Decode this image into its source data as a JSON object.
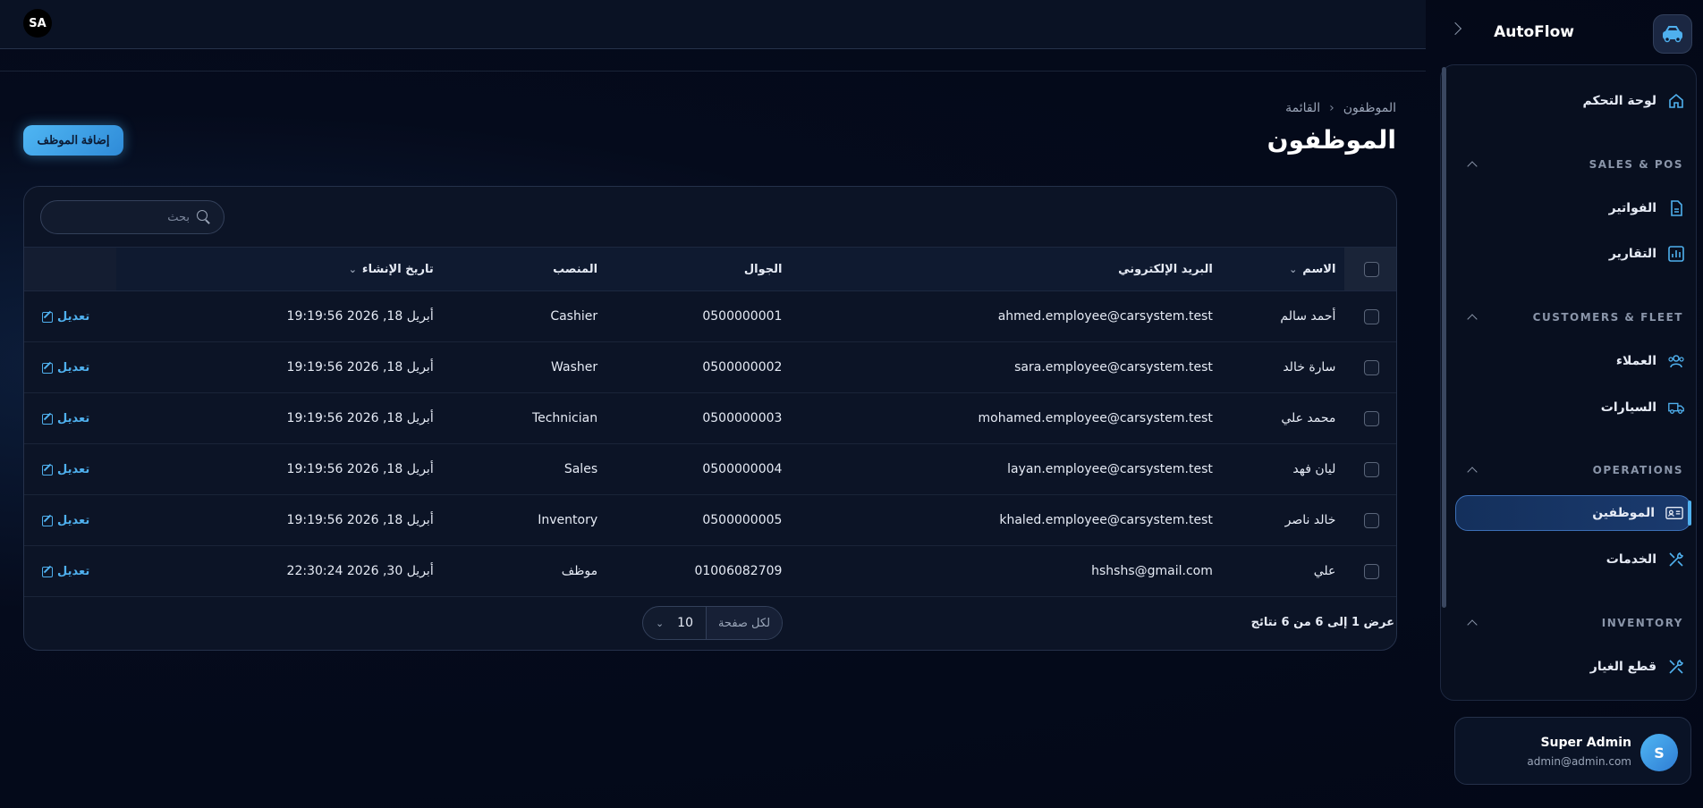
{
  "topbar": {
    "user_initials": "SA"
  },
  "breadcrumb": {
    "root": "الموظفون",
    "current": "القائمة"
  },
  "page": {
    "title": "الموظفون",
    "add_button": "إضافة الموظف"
  },
  "search": {
    "placeholder": "بحث"
  },
  "table": {
    "headers": {
      "name": "الاسم",
      "email": "البريد الإلكتروني",
      "phone": "الجوال",
      "position": "المنصب",
      "created": "تاريخ الإنشاء"
    },
    "rows": [
      {
        "name": "أحمد سالم",
        "email": "ahmed.employee@carsystem.test",
        "phone": "0500000001",
        "position": "Cashier",
        "created": "أبريل 18, 2026 19:19:56",
        "action": "تعديل"
      },
      {
        "name": "سارة خالد",
        "email": "sara.employee@carsystem.test",
        "phone": "0500000002",
        "position": "Washer",
        "created": "أبريل 18, 2026 19:19:56",
        "action": "تعديل"
      },
      {
        "name": "محمد علي",
        "email": "mohamed.employee@carsystem.test",
        "phone": "0500000003",
        "position": "Technician",
        "created": "أبريل 18, 2026 19:19:56",
        "action": "تعديل"
      },
      {
        "name": "ليان فهد",
        "email": "layan.employee@carsystem.test",
        "phone": "0500000004",
        "position": "Sales",
        "created": "أبريل 18, 2026 19:19:56",
        "action": "تعديل"
      },
      {
        "name": "خالد ناصر",
        "email": "khaled.employee@carsystem.test",
        "phone": "0500000005",
        "position": "Inventory",
        "created": "أبريل 18, 2026 19:19:56",
        "action": "تعديل"
      },
      {
        "name": "علي",
        "email": "hshshs@gmail.com",
        "phone": "01006082709",
        "position": "موظف",
        "created": "أبريل 30, 2026 22:30:24",
        "action": "تعديل"
      }
    ]
  },
  "pagination": {
    "results_text": "عرض 1 إلى 6 من 6 نتائج",
    "per_page_label": "لكل صفحة",
    "per_page_value": "10"
  },
  "sidebar": {
    "brand": "AutoFlow",
    "items": {
      "dashboard": "لوحة التحكم",
      "section_sales": "SALES & POS",
      "invoices": "الفواتير",
      "reports": "التقارير",
      "section_customers": "CUSTOMERS & FLEET",
      "customers": "العملاء",
      "cars": "السيارات",
      "section_operations": "OPERATIONS",
      "employees": "الموظفين",
      "services": "الخدمات",
      "section_inventory": "INVENTORY",
      "spare_parts": "قطع الغيار"
    }
  },
  "user": {
    "initial": "S",
    "name": "Super Admin",
    "email": "admin@admin.com"
  },
  "colors": {
    "accent": "#4fb0ee",
    "background": "#030817",
    "card": "#0c1426"
  }
}
